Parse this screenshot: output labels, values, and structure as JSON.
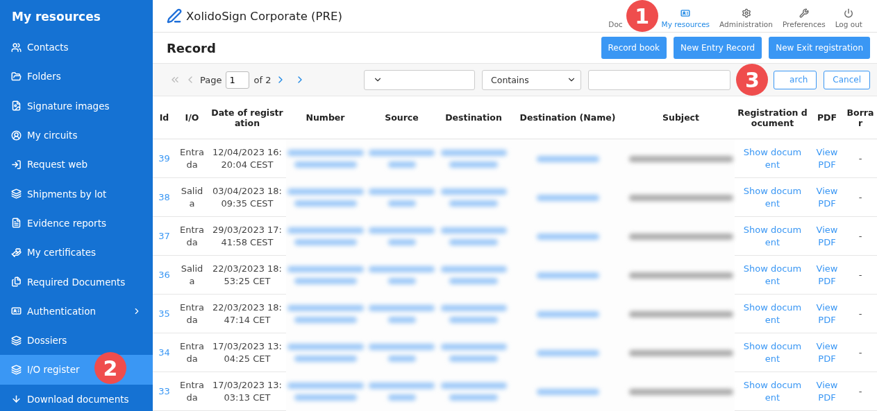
{
  "sidebar": {
    "title": "My resources",
    "items": [
      {
        "label": "Contacts",
        "selected": false
      },
      {
        "label": "Folders",
        "selected": false
      },
      {
        "label": "Signature images",
        "selected": false
      },
      {
        "label": "My circuits",
        "selected": false
      },
      {
        "label": "Request web",
        "selected": false
      },
      {
        "label": "Shipments by lot",
        "selected": false
      },
      {
        "label": "Evidence reports",
        "selected": false
      },
      {
        "label": "My certificates",
        "selected": false
      },
      {
        "label": "Required Documents",
        "selected": false
      },
      {
        "label": "Authentication",
        "selected": false,
        "expandable": true
      },
      {
        "label": "Dossiers",
        "selected": false
      },
      {
        "label": "I/O register",
        "selected": true
      },
      {
        "label": "Download documents",
        "selected": false
      }
    ]
  },
  "header": {
    "app_title": "XolidoSign Corporate (PRE)",
    "nav": [
      {
        "label": "Doc",
        "selected": false
      },
      {
        "label": "My resources",
        "selected": true
      },
      {
        "label": "Administration",
        "selected": false
      },
      {
        "label": "Preferences",
        "selected": false
      },
      {
        "label": "Log out",
        "selected": false
      }
    ]
  },
  "page": {
    "title": "Record",
    "buttons": [
      "Record book",
      "New Entry Record",
      "New Exit registration"
    ]
  },
  "pager": {
    "label": "Page",
    "value": "1",
    "of": "of 2"
  },
  "filter": {
    "operator": "Contains",
    "search_button": "arch",
    "cancel_button": "Cancel"
  },
  "callouts": [
    "1",
    "2",
    "3"
  ],
  "table": {
    "columns": [
      "Id",
      "I/O",
      "Date of registration",
      "Number",
      "Source",
      "Destination",
      "Destination (Name)",
      "Subject",
      "Registration document",
      "PDF",
      "Borrar"
    ],
    "rows": [
      {
        "id": "39",
        "io": "Entrada",
        "date": "12/04/2023 16:20:04 CEST",
        "redacted": true,
        "doc": "Show document",
        "pdf": "View PDF",
        "delete": "-"
      },
      {
        "id": "38",
        "io": "Salida",
        "date": "03/04/2023 18:09:35 CEST",
        "redacted": true,
        "doc": "Show document",
        "pdf": "View PDF",
        "delete": "-"
      },
      {
        "id": "37",
        "io": "Entrada",
        "date": "29/03/2023 17:41:58 CEST",
        "redacted": true,
        "doc": "Show document",
        "pdf": "View PDF",
        "delete": "-"
      },
      {
        "id": "36",
        "io": "Salida",
        "date": "22/03/2023 18:53:25 CET",
        "redacted": true,
        "doc": "Show document",
        "pdf": "View PDF",
        "delete": "-"
      },
      {
        "id": "35",
        "io": "Entrada",
        "date": "22/03/2023 18:47:14 CET",
        "redacted": true,
        "doc": "Show document",
        "pdf": "View PDF",
        "delete": "-"
      },
      {
        "id": "34",
        "io": "Entrada",
        "date": "17/03/2023 13:04:25 CET",
        "redacted": true,
        "doc": "Show document",
        "pdf": "View PDF",
        "delete": "-"
      },
      {
        "id": "33",
        "io": "Entrada",
        "date": "17/03/2023 13:03:13 CET",
        "redacted": true,
        "doc": "Show document",
        "pdf": "View PDF",
        "delete": "-"
      }
    ]
  }
}
